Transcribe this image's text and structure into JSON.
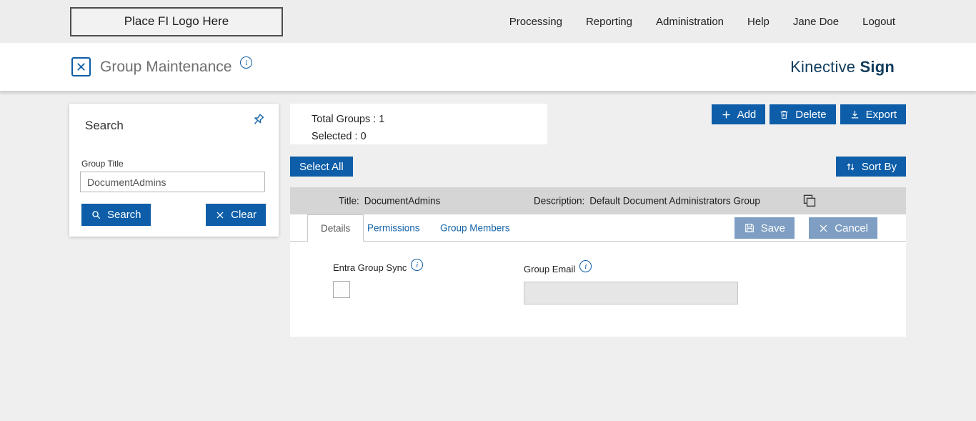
{
  "topbar": {
    "logo_placeholder": "Place FI Logo Here",
    "nav": [
      {
        "label": "Processing"
      },
      {
        "label": "Reporting"
      },
      {
        "label": "Administration"
      },
      {
        "label": "Help"
      },
      {
        "label": "Jane Doe"
      },
      {
        "label": "Logout"
      }
    ]
  },
  "header": {
    "title": "Group Maintenance",
    "brand_name": "Kinective",
    "brand_product": "Sign"
  },
  "search_panel": {
    "title": "Search",
    "group_title_label": "Group Title",
    "group_title_value": "DocumentAdmins",
    "search_button": "Search",
    "clear_button": "Clear"
  },
  "toolbar": {
    "total_groups": "Total Groups : 1",
    "selected": "Selected : 0",
    "add_button": "Add",
    "delete_button": "Delete",
    "export_button": "Export",
    "select_all_button": "Select All",
    "sort_by_button": "Sort By"
  },
  "group_row": {
    "title_label": "Title:",
    "title_value": "DocumentAdmins",
    "description_label": "Description:",
    "description_value": "Default Document Administrators Group"
  },
  "detail_panel": {
    "tabs": [
      {
        "label": "Details",
        "active": true
      },
      {
        "label": "Permissions",
        "active": false
      },
      {
        "label": "Group Members",
        "active": false
      }
    ],
    "save_button": "Save",
    "cancel_button": "Cancel",
    "entra_group_sync_label": "Entra Group Sync",
    "entra_group_sync_checked": false,
    "group_email_label": "Group Email",
    "group_email_value": ""
  },
  "colors": {
    "primary_blue": "#0d5da8",
    "muted_blue": "#7f9ec3",
    "brand_navy": "#113c5c",
    "row_gray": "#d5d5d5",
    "page_gray": "#efefef",
    "link_blue": "#1464a8"
  }
}
